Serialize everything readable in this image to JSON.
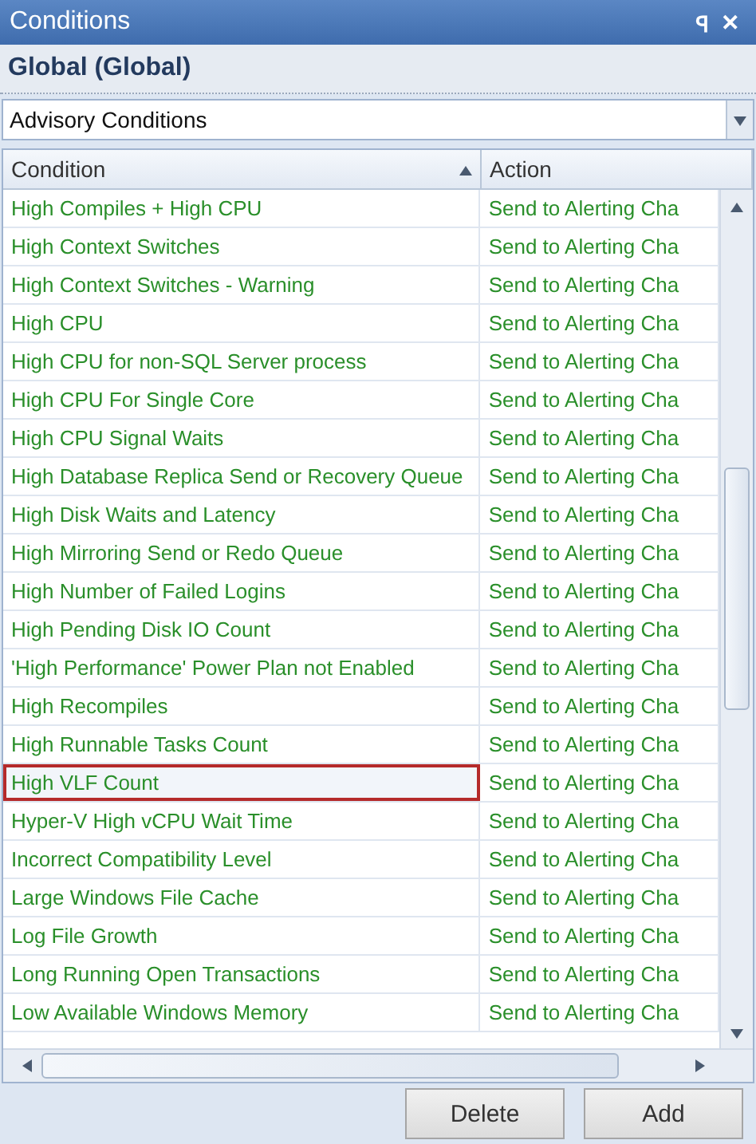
{
  "window": {
    "title": "Conditions",
    "pin_glyph": "ꟼ",
    "close_glyph": "✕"
  },
  "scope": "Global (Global)",
  "category_select": {
    "value": "Advisory Conditions"
  },
  "table": {
    "columns": [
      {
        "label": "Condition",
        "sorted": true
      },
      {
        "label": "Action",
        "sorted": false
      }
    ],
    "rows": [
      {
        "condition": "High Compiles + High CPU",
        "action": "Send to Alerting Cha",
        "selected": false
      },
      {
        "condition": "High Context Switches",
        "action": "Send to Alerting Cha",
        "selected": false
      },
      {
        "condition": "High Context Switches - Warning",
        "action": "Send to Alerting Cha",
        "selected": false
      },
      {
        "condition": "High CPU",
        "action": "Send to Alerting Cha",
        "selected": false
      },
      {
        "condition": "High CPU for non-SQL Server process",
        "action": "Send to Alerting Cha",
        "selected": false
      },
      {
        "condition": "High CPU For Single Core",
        "action": "Send to Alerting Cha",
        "selected": false
      },
      {
        "condition": "High CPU Signal Waits",
        "action": "Send to Alerting Cha",
        "selected": false
      },
      {
        "condition": "High Database Replica Send or Recovery Queue",
        "action": "Send to Alerting Cha",
        "selected": false
      },
      {
        "condition": "High Disk Waits and Latency",
        "action": "Send to Alerting Cha",
        "selected": false
      },
      {
        "condition": "High Mirroring Send or Redo Queue",
        "action": "Send to Alerting Cha",
        "selected": false
      },
      {
        "condition": "High Number of Failed Logins",
        "action": "Send to Alerting Cha",
        "selected": false
      },
      {
        "condition": "High Pending Disk IO Count",
        "action": "Send to Alerting Cha",
        "selected": false
      },
      {
        "condition": "'High Performance' Power Plan not Enabled",
        "action": "Send to Alerting Cha",
        "selected": false
      },
      {
        "condition": "High Recompiles",
        "action": "Send to Alerting Cha",
        "selected": false
      },
      {
        "condition": "High Runnable Tasks Count",
        "action": "Send to Alerting Cha",
        "selected": false
      },
      {
        "condition": "High VLF Count",
        "action": "Send to Alerting Cha",
        "selected": true
      },
      {
        "condition": "Hyper-V High vCPU Wait Time",
        "action": "Send to Alerting Cha",
        "selected": false
      },
      {
        "condition": "Incorrect Compatibility Level",
        "action": "Send to Alerting Cha",
        "selected": false
      },
      {
        "condition": "Large Windows File Cache",
        "action": "Send to Alerting Cha",
        "selected": false
      },
      {
        "condition": "Log File Growth",
        "action": "Send to Alerting Cha",
        "selected": false
      },
      {
        "condition": "Long Running Open Transactions",
        "action": "Send to Alerting Cha",
        "selected": false
      },
      {
        "condition": "Low Available Windows Memory",
        "action": "Send to Alerting Cha",
        "selected": false
      }
    ]
  },
  "buttons": [
    {
      "label": "Delete"
    },
    {
      "label": "Add"
    }
  ]
}
